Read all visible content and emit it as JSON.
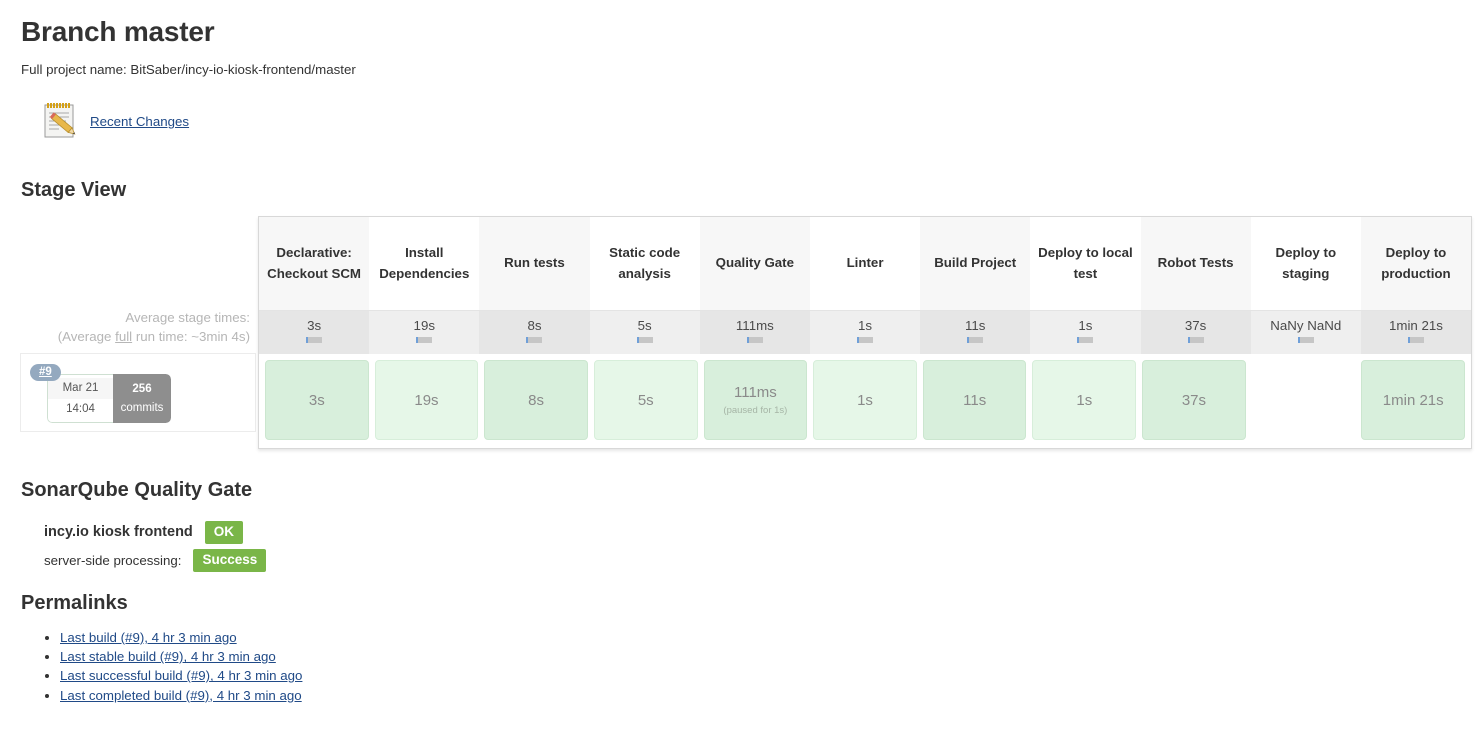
{
  "header": {
    "title": "Branch master",
    "full_project_label": "Full project name: BitSaber/incy-io-kiosk-frontend/master",
    "recent_changes_label": "Recent Changes",
    "notepad_icon": "notepad-pencil-icon"
  },
  "sections": {
    "stage_view": "Stage View",
    "sonarqube": "SonarQube Quality Gate",
    "permalinks": "Permalinks"
  },
  "stage_view": {
    "average_label_line1": "Average stage times:",
    "average_label_line2_pre": "(Average ",
    "average_label_line2_em": "full",
    "average_label_line2_post": " run time: ~3min 4s)",
    "stages": [
      {
        "name": "Declarative: Checkout SCM",
        "average": "3s",
        "duration": "3s",
        "status": "success",
        "note": ""
      },
      {
        "name": "Install Dependencies",
        "average": "19s",
        "duration": "19s",
        "status": "success",
        "note": ""
      },
      {
        "name": "Run tests",
        "average": "8s",
        "duration": "8s",
        "status": "success",
        "note": ""
      },
      {
        "name": "Static code analysis",
        "average": "5s",
        "duration": "5s",
        "status": "success",
        "note": ""
      },
      {
        "name": "Quality Gate",
        "average": "111ms",
        "duration": "111ms",
        "status": "success",
        "note": "(paused for 1s)"
      },
      {
        "name": "Linter",
        "average": "1s",
        "duration": "1s",
        "status": "success",
        "note": ""
      },
      {
        "name": "Build Project",
        "average": "11s",
        "duration": "11s",
        "status": "success",
        "note": ""
      },
      {
        "name": "Deploy to local test",
        "average": "1s",
        "duration": "1s",
        "status": "success",
        "note": ""
      },
      {
        "name": "Robot Tests",
        "average": "37s",
        "duration": "37s",
        "status": "success",
        "note": ""
      },
      {
        "name": "Deploy to staging",
        "average": "NaNy NaNd",
        "duration": "",
        "status": "empty",
        "note": ""
      },
      {
        "name": "Deploy to production",
        "average": "1min 21s",
        "duration": "1min 21s",
        "status": "success",
        "note": ""
      }
    ],
    "build": {
      "number": "#9",
      "date": "Mar 21",
      "time": "14:04",
      "commits_count": "256",
      "commits_label": "commits"
    }
  },
  "sonarqube": {
    "project_name": "incy.io kiosk frontend",
    "gate_status": "OK",
    "processing_label": "server-side processing:",
    "processing_status": "Success",
    "badge_color": "#7ab648"
  },
  "permalinks": [
    "Last build (#9), 4 hr 3 min ago",
    "Last stable build (#9), 4 hr 3 min ago",
    "Last successful build (#9), 4 hr 3 min ago",
    "Last completed build (#9), 4 hr 3 min ago"
  ]
}
